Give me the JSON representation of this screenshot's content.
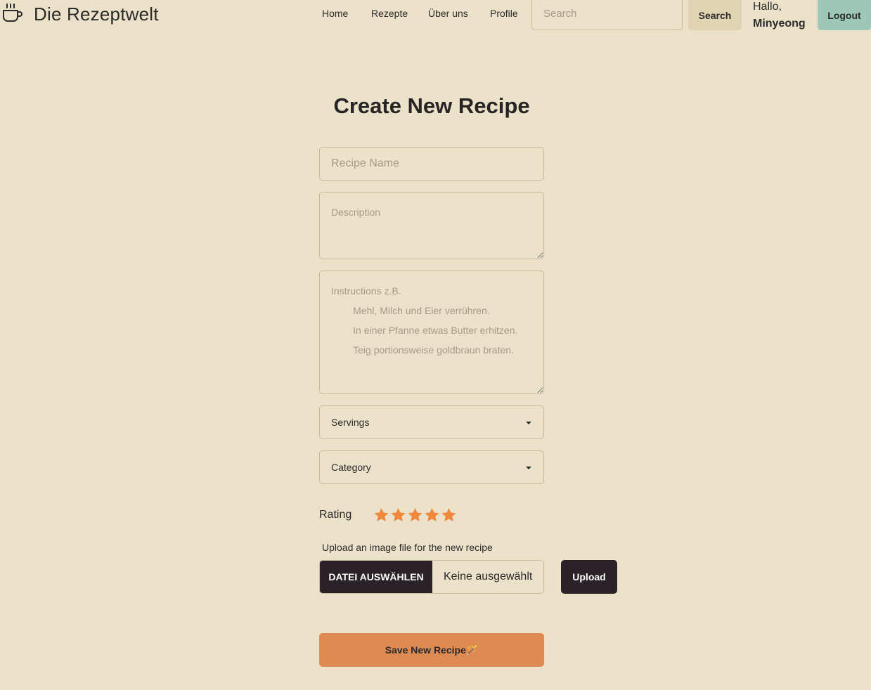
{
  "header": {
    "brand_icon": "coffee-cup-icon",
    "brand_title": "Die Rezeptwelt",
    "nav": {
      "home": "Home",
      "recipes": "Rezepte",
      "about": "Über uns",
      "profile": "Profile"
    },
    "search_placeholder": "Search",
    "search_button": "Search",
    "greeting": "Hallo,",
    "username": "Minyeong",
    "logout_button": "Logout"
  },
  "form": {
    "title": "Create New Recipe",
    "recipe_name_placeholder": "Recipe Name",
    "description_placeholder": "Description",
    "instructions_placeholder": "Instructions z.B.\n        Mehl, Milch und Eier verrühren.\n        In einer Pfanne etwas Butter erhitzen.\n        Teig portionsweise goldbraun braten.",
    "servings_label": "Servings",
    "category_label": "Category",
    "rating_label": "Rating",
    "rating_value": 5,
    "rating_max": 5,
    "upload_label": "Upload an image file for the new recipe",
    "file_button": "DATEI AUSWÄHLEN",
    "file_status": "Keine ausgewählt",
    "upload_button": "Upload",
    "save_button": "Save New Recipe🪄"
  },
  "colors": {
    "background": "#ece1c9",
    "star": "#f0893e",
    "save_button": "#de8a53",
    "logout_button": "#9dc8b5",
    "dark_button": "#2a2226"
  }
}
